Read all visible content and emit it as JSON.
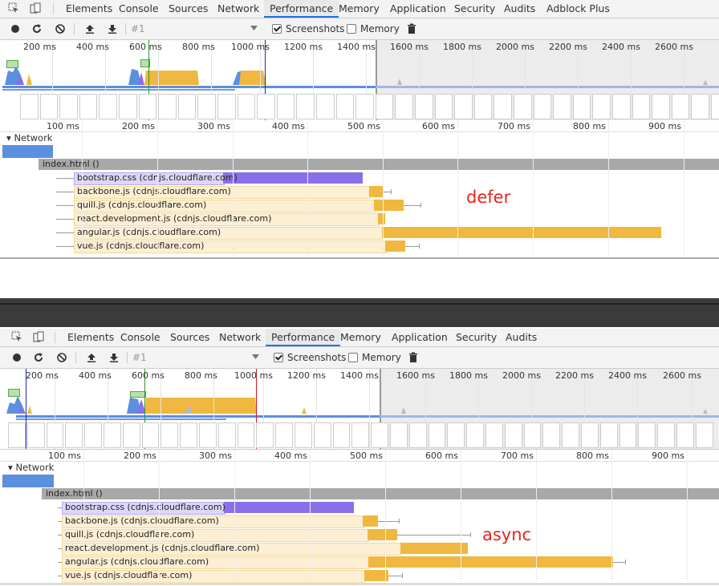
{
  "tabs": [
    "Elements",
    "Console",
    "Sources",
    "Network",
    "Performance",
    "Memory",
    "Application",
    "Security",
    "Audits",
    "Adblock Plus"
  ],
  "tabs2": [
    "Elements",
    "Console",
    "Sources",
    "Network",
    "Performance",
    "Memory",
    "Application",
    "Security",
    "Audits"
  ],
  "active_tab": "Performance",
  "toolbar": {
    "recording": "#1",
    "screenshots": "Screenshots",
    "memory": "Memory"
  },
  "overview_ticks": [
    "200 ms",
    "400 ms",
    "600 ms",
    "800 ms",
    "1000 ms",
    "1200 ms",
    "1400 ms",
    "1600 ms",
    "1800 ms",
    "2000 ms",
    "2200 ms",
    "2400 ms",
    "2600 ms"
  ],
  "main_ticks": [
    "100 ms",
    "200 ms",
    "300 ms",
    "400 ms",
    "500 ms",
    "600 ms",
    "700 ms",
    "800 ms",
    "900 ms"
  ],
  "network_label": "Network",
  "index_label": "index.html ()",
  "requests": [
    "bootstrap.css (cdnjs.cloudflare.com)",
    "backbone.js (cdnjs.cloudflare.com)",
    "quill.js (cdnjs.cloudflare.com)",
    "react.development.js (cdnjs.cloudflare.com)",
    "angular.js (cdnjs.cloudflare.com)",
    "vue.js (cdnjs.cloudflare.com)"
  ],
  "annotation_top": "defer",
  "annotation_bottom": "async",
  "colors": {
    "css": "#8b6fe8",
    "css_light": "#ddd6f8",
    "js": "#f0b840",
    "js_light": "#fcefd3",
    "network": "#5b8fe0",
    "index": "#a8a8a8",
    "annot": "#e8241b"
  }
}
